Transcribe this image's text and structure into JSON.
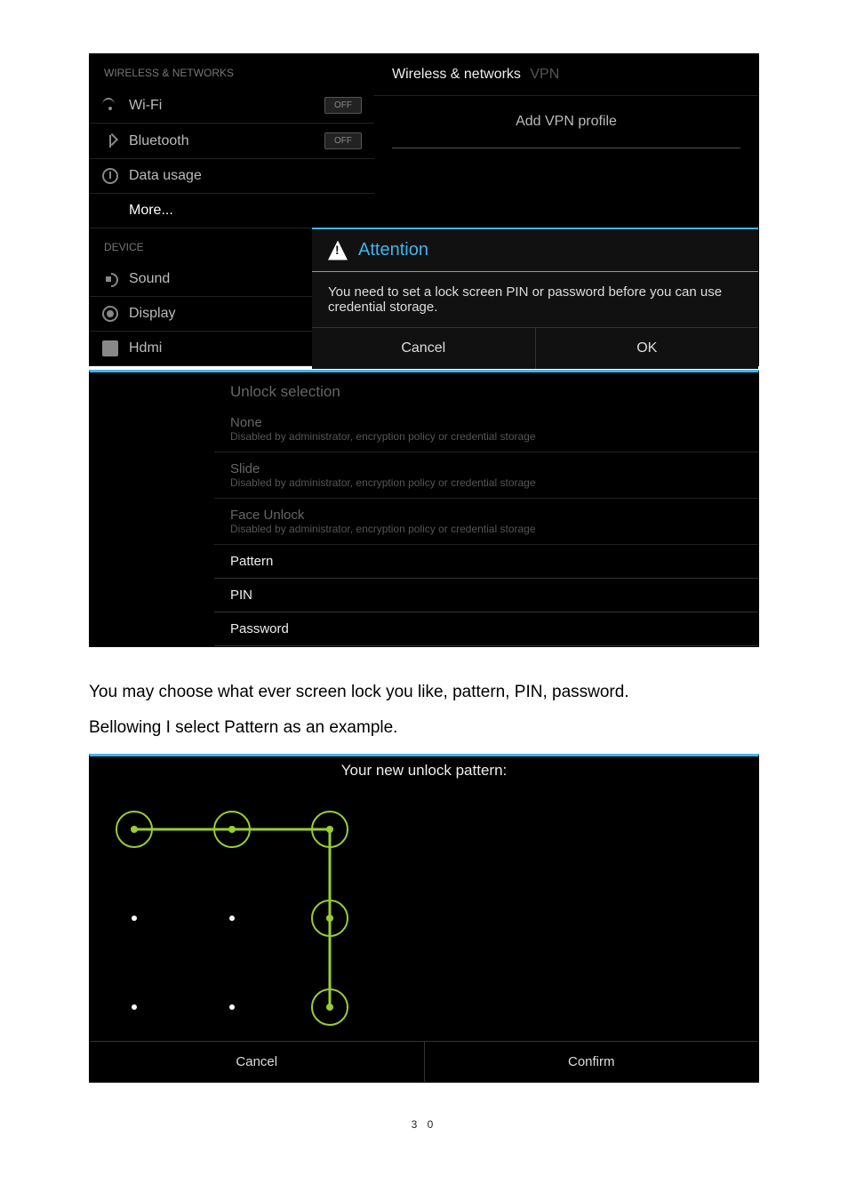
{
  "ss1": {
    "wireless_header": "WIRELESS & NETWORKS",
    "device_header": "DEVICE",
    "wifi": "Wi-Fi",
    "bluetooth": "Bluetooth",
    "data_usage": "Data usage",
    "more": "More...",
    "sound": "Sound",
    "display": "Display",
    "hdmi": "Hdmi",
    "off": "OFF",
    "right_title": "Wireless & networks",
    "right_sub": "VPN",
    "add_vpn": "Add VPN profile",
    "dialog_title": "Attention",
    "dialog_msg": "You need to set a lock screen PIN or password before you can use credential storage.",
    "cancel": "Cancel",
    "ok": "OK"
  },
  "ss2": {
    "title": "Unlock selection",
    "none": "None",
    "slide": "Slide",
    "face": "Face Unlock",
    "disabled_msg": "Disabled by administrator, encryption policy or credential storage",
    "pattern": "Pattern",
    "pin": "PIN",
    "password": "Password"
  },
  "body": {
    "p1": "You may choose what ever screen lock you like, pattern, PIN, password.",
    "p2": "Bellowing I select Pattern as an example."
  },
  "ss3": {
    "title": "Your new unlock pattern:",
    "cancel": "Cancel",
    "confirm": "Confirm"
  },
  "page_number": "3 0"
}
